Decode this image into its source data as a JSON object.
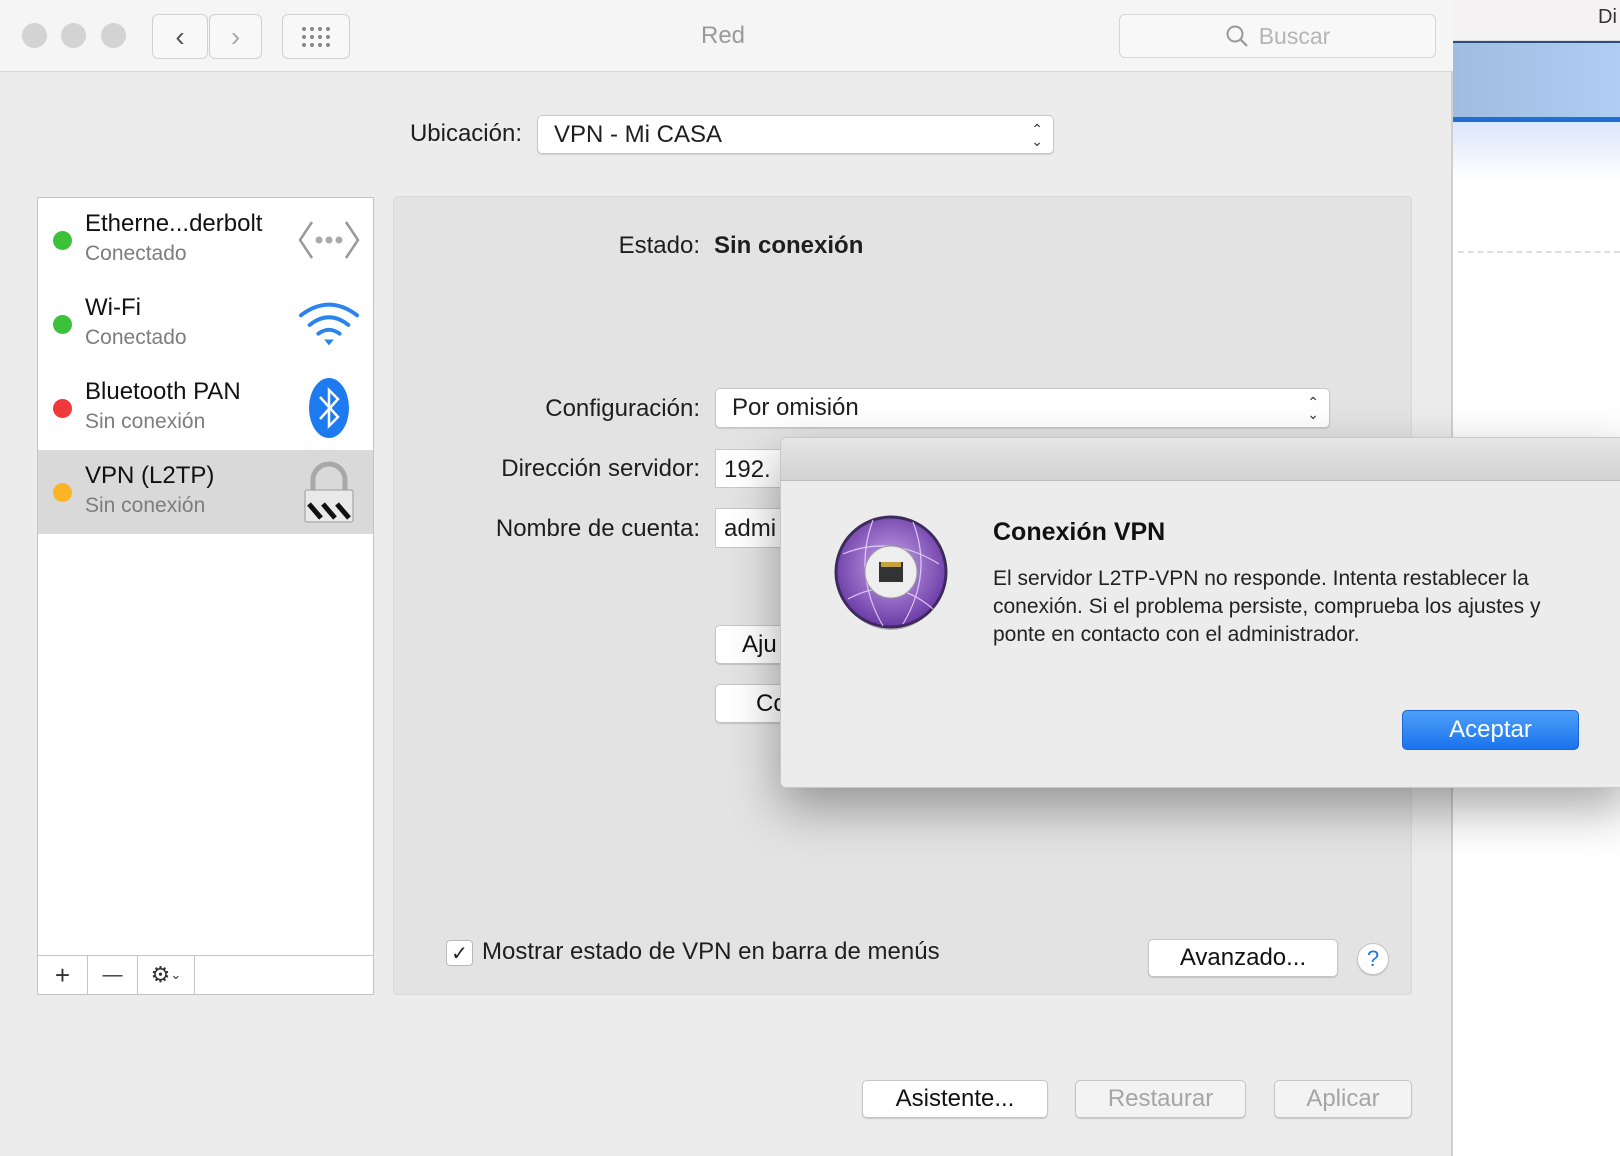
{
  "background_window": {
    "title_fragment": "Di"
  },
  "window": {
    "title": "Red",
    "search_placeholder": "Buscar"
  },
  "location": {
    "label": "Ubicación:",
    "value": "VPN - Mi CASA"
  },
  "services": [
    {
      "name": "Etherne...derbolt",
      "status": "Conectado",
      "status_color": "#3cc13b",
      "icon": "ethernet-icon"
    },
    {
      "name": "Wi-Fi",
      "status": "Conectado",
      "status_color": "#3cc13b",
      "icon": "wifi-icon"
    },
    {
      "name": "Bluetooth PAN",
      "status": "Sin conexión",
      "status_color": "#f0393a",
      "icon": "bluetooth-icon"
    },
    {
      "name": "VPN (L2TP)",
      "status": "Sin conexión",
      "status_color": "#fbb425",
      "icon": "vpn-lock-icon",
      "selected": true
    }
  ],
  "sidebar_tools": {
    "add": "+",
    "remove": "—"
  },
  "detail": {
    "status_label": "Estado:",
    "status_value": "Sin conexión",
    "config_label": "Configuración:",
    "config_value": "Por omisión",
    "server_label": "Dirección servidor:",
    "server_value": "192.",
    "account_label": "Nombre de cuenta:",
    "account_value": "admi",
    "auth_button": "Aju",
    "connect_button": "Co",
    "show_vpn_status_label": "Mostrar estado de VPN en barra de menús",
    "show_vpn_status_checked": true,
    "advanced_button": "Avanzado...",
    "help_button": "?"
  },
  "footer": {
    "assistant": "Asistente...",
    "revert": "Restaurar",
    "apply": "Aplicar"
  },
  "dialog": {
    "title": "Conexión VPN",
    "message": "El servidor L2TP-VPN no responde. Intenta restablecer la conexión. Si el problema persiste, comprueba los ajustes y ponte en contacto con el administrador.",
    "ok_button": "Aceptar"
  }
}
